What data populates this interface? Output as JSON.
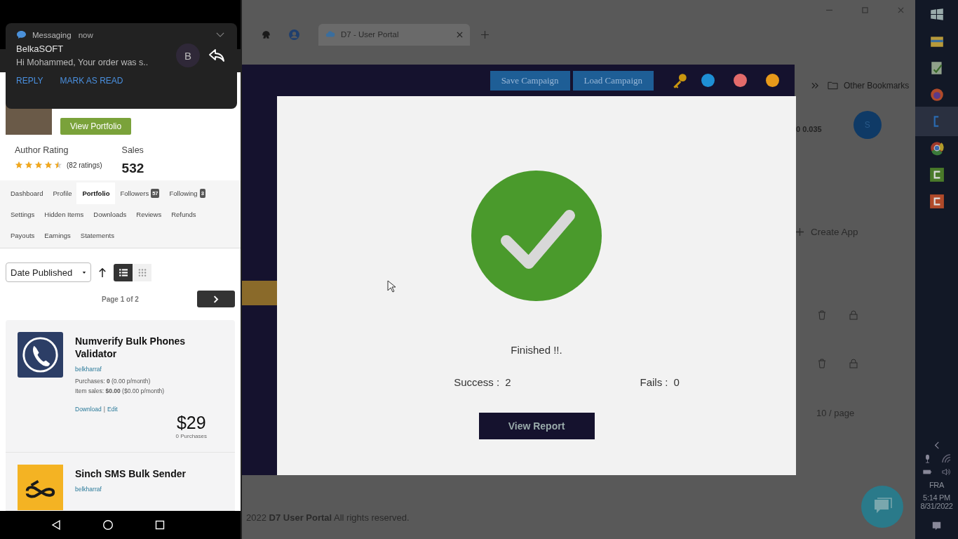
{
  "notification": {
    "app": "Messaging",
    "time": "now",
    "sender": "BelkaSOFT",
    "message": "Hi Mohammed, Your order was s..",
    "avatar_letter": "B",
    "actions": [
      "REPLY",
      "MARK AS READ"
    ]
  },
  "profile": {
    "button": "View Portfolio",
    "rating_label": "Author Rating",
    "stars": 4.5,
    "ratings_count": "(82 ratings)",
    "sales_label": "Sales",
    "sales": "532"
  },
  "nav_rows": [
    [
      {
        "label": "Dashboard",
        "selected": false
      },
      {
        "label": "Profile",
        "selected": false
      },
      {
        "label": "Portfolio",
        "selected": true
      },
      {
        "label": "Followers",
        "badge": "57",
        "selected": false
      },
      {
        "label": "Following",
        "badge": "3",
        "selected": false
      }
    ],
    [
      {
        "label": "Settings",
        "selected": false
      },
      {
        "label": "Hidden Items",
        "selected": false
      },
      {
        "label": "Downloads",
        "selected": false
      },
      {
        "label": "Reviews",
        "selected": false
      },
      {
        "label": "Refunds",
        "selected": false
      }
    ],
    [
      {
        "label": "Payouts",
        "selected": false
      },
      {
        "label": "Earnings",
        "selected": false
      },
      {
        "label": "Statements",
        "selected": false
      }
    ]
  ],
  "sort": {
    "value": "Date Published",
    "views": [
      {
        "kind": "list",
        "selected": true
      },
      {
        "kind": "grid",
        "selected": false
      }
    ]
  },
  "pagination": {
    "label": "Page 1 of 2"
  },
  "items": [
    {
      "kind": "phone",
      "title": "Numverify Bulk Phones Validator",
      "author": "belkharraf",
      "stats": [
        "Purchases: **0** (0.00 p/month)",
        "Item sales: **$0.00** ($0.00 p/month)"
      ],
      "links": [
        "Download",
        "Edit"
      ],
      "link_separator": "|",
      "price": "$29",
      "purchases": "0 Purchases"
    },
    {
      "kind": "sinch",
      "title": "Sinch SMS Bulk Sender",
      "author": "belkharraf"
    }
  ],
  "browser": {
    "tab_title": "D7 - User Portal",
    "bookmarks": "Other Bookmarks"
  },
  "app_header": {
    "buttons": [
      "Save Campaign",
      "Load Campaign"
    ],
    "dots": [
      {
        "color": "#1e8fd4"
      },
      {
        "color": "#e36b6b"
      },
      {
        "color": "#e89a1a"
      }
    ]
  },
  "modal": {
    "status": "Finished !!.",
    "success_label": "Success :",
    "success_value": "2",
    "fails_label": "Fails :",
    "fails_value": "0",
    "button": "View Report"
  },
  "background": {
    "credit": "0 0.035",
    "avatar_letter": "S",
    "create_button": "Create App",
    "page_size": "10 / page",
    "footer_year": "2022",
    "footer_brand": "D7 User Portal",
    "footer_rest": "All rights reserved."
  },
  "taskbar": {
    "language": "FRA",
    "time": "5:14 PM",
    "date": "8/31/2022"
  }
}
